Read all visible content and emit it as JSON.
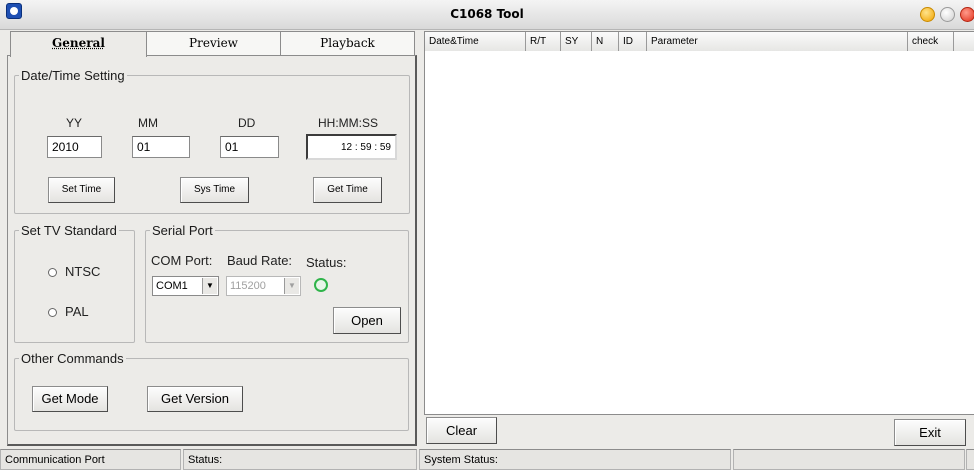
{
  "window": {
    "title": "C1068 Tool"
  },
  "tabs": [
    {
      "label": "General"
    },
    {
      "label": "Preview"
    },
    {
      "label": "Playback"
    }
  ],
  "datetime": {
    "legend": "Date/Time Setting",
    "yy_label": "YY",
    "mm_label": "MM",
    "dd_label": "DD",
    "hms_label": "HH:MM:SS",
    "yy": "2010",
    "mm": "01",
    "dd": "01",
    "hour": "12",
    "minute": "59",
    "second": "59",
    "set_time": "Set Time",
    "sys_time": "Sys Time",
    "get_time": "Get Time"
  },
  "tv": {
    "legend": "Set TV Standard",
    "ntsc": "NTSC",
    "pal": "PAL"
  },
  "serial": {
    "legend": "Serial Port",
    "com_label": "COM Port:",
    "baud_label": "Baud Rate:",
    "status_label": "Status:",
    "com_value": "COM1",
    "baud_value": "115200",
    "open": "Open",
    "status_color": "#2fb44a"
  },
  "commands": {
    "legend": "Other Commands",
    "get_mode": "Get Mode",
    "get_version": "Get Version"
  },
  "log": {
    "columns": [
      "Date&Time",
      "R/T",
      "SY",
      "N",
      "ID",
      "Parameter",
      "check"
    ]
  },
  "buttons": {
    "clear": "Clear",
    "exit": "Exit"
  },
  "statusbar": {
    "comm_port": "Communication Port",
    "status": "Status:",
    "system_status": "System Status:"
  }
}
